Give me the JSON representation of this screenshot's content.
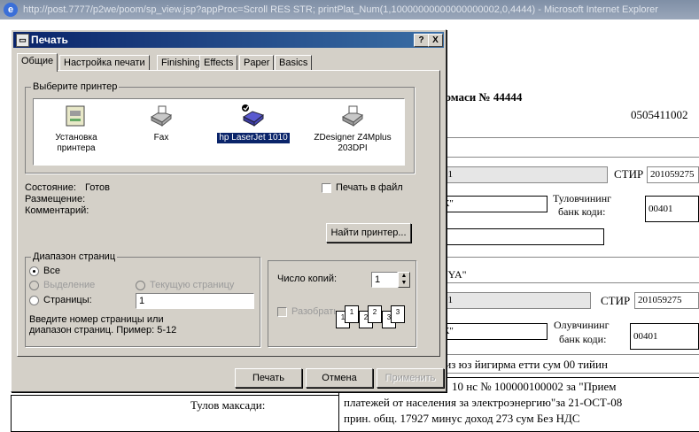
{
  "browser": {
    "title": "http://post.7777/p2we/poom/sp_view.jsp?appProc=Scroll RES STR; printPlat_Num(1,10000000000000000002,0,4444) - Microsoft Internet Explorer"
  },
  "document": {
    "heading": "номаси № 44444",
    "number": "0505411002",
    "row1_value": "01",
    "stir_label": "СТИР",
    "stir_value_1": "201059275",
    "row2_value": "К\"",
    "payer_bank_label_1": "Туловчининг",
    "payer_bank_label_2": "банк коди:",
    "payer_bank_code": "00401",
    "receiver_name": "NYA\"",
    "row3_value": "01",
    "stir_value_2": "201059275",
    "row4_value": "К\"",
    "receiver_bank_label_1": "Олувчининг",
    "receiver_bank_label_2": "банк коди:",
    "receiver_bank_code": "00401",
    "amount_words": "киз юз йигирма етти сум 00 тийин",
    "purpose_label": "Тулов максади:",
    "purpose_line1": "10 нс № 100000100002 за \"Прием",
    "purpose_line2": "платежей от населения за электроэнергию\"за 21-ОСТ-08",
    "purpose_line3": "прин. общ. 17927 минус доход 273 сум Без НДС"
  },
  "dialog": {
    "title": "Печать",
    "help_btn": "?",
    "close_btn": "X",
    "tabs": [
      "Общие",
      "Настройка печати",
      "Finishing",
      "Effects",
      "Paper",
      "Basics"
    ],
    "printer_group_label": "Выберите принтер",
    "printers": [
      {
        "name": "Установка принтера",
        "icon": "add-printer-icon"
      },
      {
        "name": "Fax",
        "icon": "fax-icon"
      },
      {
        "name": "hp LaserJet 1010",
        "icon": "printer-icon"
      },
      {
        "name": "ZDesigner Z4Mplus 203DPI",
        "icon": "printer-icon"
      }
    ],
    "status_label": "Состояние:",
    "status_value": "Готов",
    "location_label": "Размещение:",
    "comment_label": "Комментарий:",
    "print_to_file_label": "Печать в файл",
    "find_printer_btn": "Найти принтер...",
    "range_group_label": "Диапазон страниц",
    "range_all": "Все",
    "range_selection": "Выделение",
    "range_current": "Текущую страницу",
    "range_pages": "Страницы:",
    "pages_value": "1",
    "range_help": "Введите номер страницы или диапазон страниц. Пример: 5-12",
    "copies_label": "Число копий:",
    "copies_value": "1",
    "collate_label": "Разобрать",
    "collate_pages": [
      "1",
      "1",
      "2",
      "2",
      "3",
      "3"
    ],
    "print_btn": "Печать",
    "cancel_btn": "Отмена",
    "apply_btn": "Применить"
  }
}
